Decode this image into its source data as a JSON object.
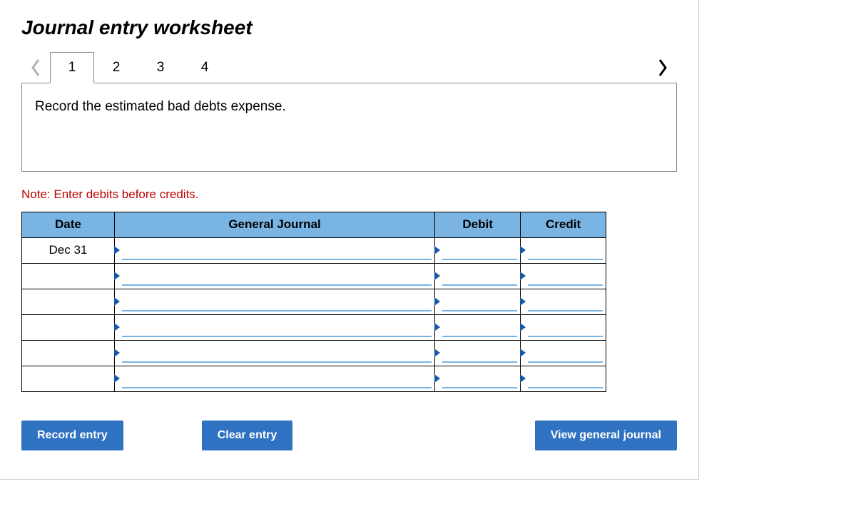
{
  "title": "Journal entry worksheet",
  "nav": {
    "left_icon": "chevron-left",
    "right_icon": "chevron-right"
  },
  "tabs": [
    "1",
    "2",
    "3",
    "4"
  ],
  "active_tab_index": 0,
  "instruction": "Record the estimated bad debts expense.",
  "note": "Note: Enter debits before credits.",
  "columns": {
    "date": "Date",
    "gj": "General Journal",
    "debit": "Debit",
    "credit": "Credit"
  },
  "rows": [
    {
      "date": "Dec 31"
    },
    {
      "date": ""
    },
    {
      "date": ""
    },
    {
      "date": ""
    },
    {
      "date": ""
    },
    {
      "date": ""
    }
  ],
  "buttons": {
    "record": "Record entry",
    "clear": "Clear entry",
    "view": "View general journal"
  }
}
